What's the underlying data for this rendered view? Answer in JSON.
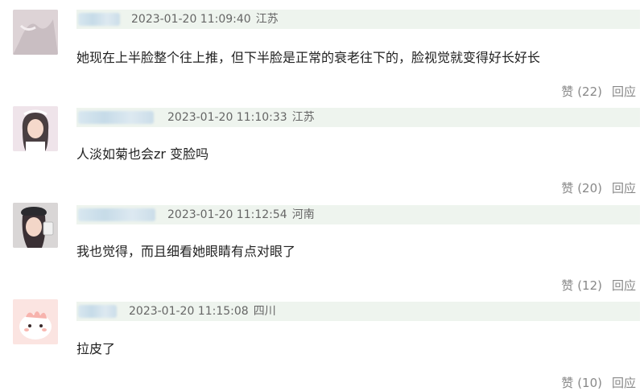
{
  "comments": [
    {
      "timestamp": "2023-01-20 11:09:40",
      "location": "江苏",
      "text": "她现在上半脸整个往上推，但下半脸是正常的衰老往下的，脸视觉就变得好长好长",
      "like_label": "赞 (22)",
      "reply_label": "回应"
    },
    {
      "timestamp": "2023-01-20 11:10:33",
      "location": "江苏",
      "text": "人淡如菊也会zr 变脸吗",
      "like_label": "赞 (20)",
      "reply_label": "回应"
    },
    {
      "timestamp": "2023-01-20 11:12:54",
      "location": "河南",
      "text": "我也觉得，而且细看她眼睛有点对眼了",
      "like_label": "赞 (12)",
      "reply_label": "回应"
    },
    {
      "timestamp": "2023-01-20 11:15:08",
      "location": "四川",
      "text": "拉皮了",
      "like_label": "赞 (10)",
      "reply_label": "回应"
    }
  ],
  "colors": {
    "header_bg": "#eef4ee",
    "meta_text": "#666666",
    "action_text": "#888888"
  }
}
